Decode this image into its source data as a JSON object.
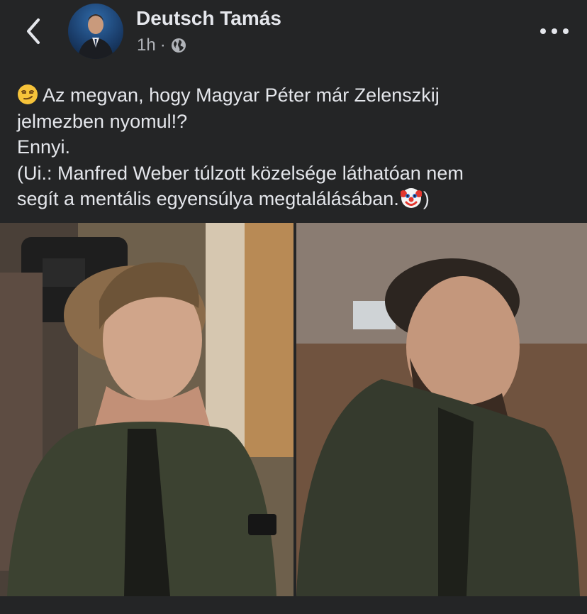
{
  "header": {
    "back_icon": "chevron-left-icon",
    "author_name": "Deutsch Tamás",
    "time": "1h",
    "separator": "·",
    "privacy_icon": "globe-icon",
    "more_icon": "more-horizontal-icon"
  },
  "post": {
    "lines": [
      "Az megvan, hogy Magyar Péter már Zelenszkij",
      "jelmezben nyomul!?",
      "Ennyi.",
      "(Ui.: Manfred Weber túlzott közelsége láthatóan nem",
      "segít a mentális egyensúlya megtalálásában.",
      ")"
    ],
    "leading_emoji": "smirking-face-emoji",
    "inline_emoji": "clown-face-emoji"
  },
  "photos": [
    {
      "icon": "photo-man-left"
    },
    {
      "icon": "photo-man-right"
    }
  ],
  "colors": {
    "background": "#242526",
    "text_primary": "#e4e6eb",
    "text_secondary": "#b0b3b8"
  }
}
